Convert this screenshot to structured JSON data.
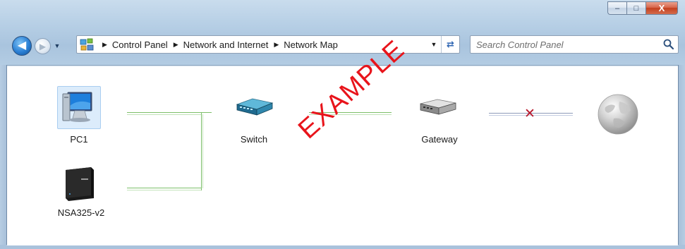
{
  "window": {
    "caption_buttons": {
      "minimize": "–",
      "maximize": "□",
      "close": "X"
    }
  },
  "navigation": {
    "back_icon": "back-arrow-icon",
    "forward_icon": "forward-arrow-icon",
    "breadcrumbs": [
      "Control Panel",
      "Network and Internet",
      "Network Map"
    ],
    "search_placeholder": "Search Control Panel"
  },
  "map": {
    "nodes": {
      "pc1": "PC1",
      "nas": "NSA325-v2",
      "switch": "Switch",
      "gateway": "Gateway",
      "internet_icon": "globe-icon"
    },
    "connection_colors": {
      "wired": "#7dbf6a",
      "broken_link": "#8e9ab8",
      "broken_mark": "#b8182c"
    },
    "watermark": "EXAMPLE"
  }
}
